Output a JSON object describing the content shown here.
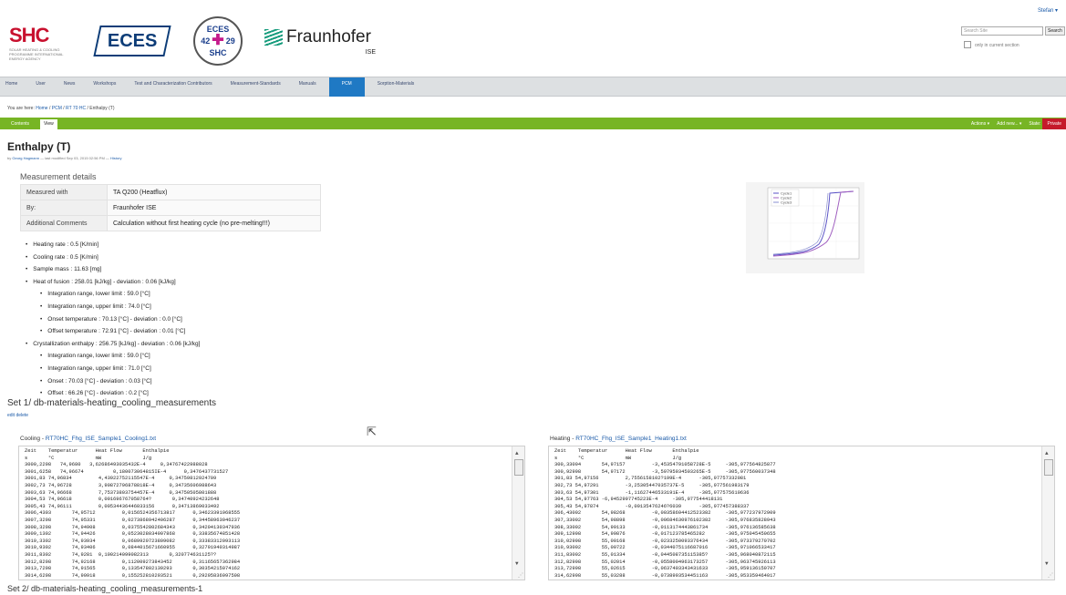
{
  "header": {
    "logos": {
      "shc": {
        "text": "SHC",
        "subtitle": "SOLAR HEATING & COOLING PROGRAMME INTERNATIONAL ENERGY AGENCY"
      },
      "eces": {
        "text": "ECES"
      },
      "eces_annex": {
        "top": "ECES",
        "left": "42",
        "right": "29",
        "bottom": "SHC"
      },
      "fraunhofer": {
        "name": "Fraunhofer",
        "sub": "ISE"
      }
    },
    "user_menu": "Stefan ▾",
    "search": {
      "placeholder": "Search Site",
      "button": "Search",
      "checkbox_label": "only in current section"
    }
  },
  "nav": {
    "items": [
      {
        "label": "Home"
      },
      {
        "label": "User"
      },
      {
        "label": "News"
      },
      {
        "label": "Workshops"
      },
      {
        "label": "Test and Characterization Contributors"
      },
      {
        "label": "Measurement-Standards"
      },
      {
        "label": "Manuals"
      },
      {
        "label": "PCM"
      },
      {
        "label": "Sorption-Materials"
      }
    ],
    "active": "PCM"
  },
  "breadcrumb": {
    "prefix": "You are here:",
    "home": "Home",
    "sep1": "/",
    "pcm": "PCM",
    "sep2": "/",
    "rt70": "RT 70 HC",
    "sep3": "/",
    "current": "Enthalpy (T)"
  },
  "toolbar": {
    "tabs": {
      "contents": "Contents",
      "view": "View"
    },
    "actions": "Actions ▾",
    "add_new": "Add new... ▾",
    "state_label": "State:",
    "state": "Private"
  },
  "page": {
    "title": "Enthalpy (T)",
    "byline_prefix": "by",
    "byline_author": "Georg Hagmann",
    "byline_modified": "— last modified Sep 03, 2015 02:56 PM —",
    "byline_history": "History"
  },
  "details": {
    "heading": "Measurement details",
    "rows": [
      {
        "key": "Measured with",
        "value": "TA Q200 (Heatflux)"
      },
      {
        "key": "By:",
        "value": "Fraunhofer ISE"
      },
      {
        "key": "Additional Comments",
        "value": "Calculation without first heating cycle (no pre-melting!!!)"
      }
    ]
  },
  "plot": {
    "legend": [
      "Cycle1",
      "Cycle2",
      "Cycle3"
    ],
    "colors": {
      "cycle1": "#5a52c6",
      "cycle2": "#a05fc0",
      "cycle3": "#8a8fd0"
    }
  },
  "properties": [
    {
      "level": 1,
      "text": "Heating rate      : 0.5 [K/min]"
    },
    {
      "level": 1,
      "text": "Cooling rate      : 0.5 [K/min]"
    },
    {
      "level": 1,
      "text": "Sample mass      : 11.63 [mg]"
    },
    {
      "level": 1,
      "text": "Heat of fusion      : 258.01 [kJ/kg] - deviation      : 0.06 [kJ/kg]"
    },
    {
      "level": 2,
      "text": "Integration range, lower limit      : 59.0 [°C]"
    },
    {
      "level": 2,
      "text": "Integration range, upper limit      : 74.0 [°C]"
    },
    {
      "level": 2,
      "text": "Onset temperature      : 70.13 [°C] - deviation      : 0.0 [°C]"
    },
    {
      "level": 2,
      "text": "Offset temperature      : 72.91 [°C] - deviation      : 0.01 [°C]"
    },
    {
      "level": 1,
      "text": "Crystallization enthalpy      : 256.75 [kJ/kg] - deviation      : 0.06 [kJ/kg]"
    },
    {
      "level": 2,
      "text": "Integration range, lower limit      : 59.0 [°C]"
    },
    {
      "level": 2,
      "text": "Integration range, upper limit      : 71.0 [°C]"
    },
    {
      "level": 2,
      "text": "Onset      : 70.03 [°C] - deviation      : 0.03 [°C]"
    },
    {
      "level": 2,
      "text": "Offset      : 66.26 [°C] - deviation      : 0.2 [°C]"
    }
  ],
  "set1": {
    "title": "Set 1/ db-materials-heating_cooling_measurements",
    "edit": "edit",
    "delete": "delete"
  },
  "cooling": {
    "prefix": "Cooling -",
    "file": "RT70HC_Fhg_ISE_Sample1_Cooling1.txt",
    "lines": [
      "Zeit    Temperatur      Heat Flow       Enthalpie",
      "s       °C              mW              J/g",
      "3000,2298   74,9680   3,62686493035432E-4     0,34767422988028",
      "3001,6258   74,96674          0,180073064815IE-4      0,3476437731527",
      "3001,83 74,96834         4,43922752115547E-4     0,34759812924709",
      "3002,73 74,96728         3,90872796878818E-4     0,34735606988643",
      "3003,63 74,96668         7,75373803754457E-4     0,34750505801888",
      "3004,53 74,96618         0,001696767058764?       0,34740924232648",
      "3005,43 74,96111         0,00534436446033156      0,34713869033492",
      "3006,4303       74,95712         0,0156524356713817      0,34623391968555",
      "3007,3298       74,95331         0,0273868942406287      0,34458963046237",
      "3008,3298       74,94908         0,0375542802684343      0,34204130347936",
      "3009,1302       74,94426         0,0523028034907868      0,33835674851428",
      "3010,3302       74,93934         0,0689920723809082      0,33383312093113",
      "3010,9302       74,93406         0,0844015671660955      0,32791940314987",
      "3011,8302       74,9281  0,100214099082313       0,320774631125??",
      "3012,8298       74,92168         0,112009273843452       0,31165657362984",
      "3013,7298       74,91565         0,133547802139293       0,30354215074162",
      "3014,6298       74,90918         0,155252810293521       0,29295836997508"
    ]
  },
  "heating": {
    "prefix": "Heating -",
    "file": "RT70HC_Fhg_ISE_Sample1_Heating1.txt",
    "lines": [
      "Zeit    Temperatur      Heat Flow       Enthalpie",
      "s       °C              mW              J/g",
      "300,33004       54,97157         -3,45354791058728E-5     -305,977564825877",
      "300,92998       54,97172         -3,59795934503265E-5     -305,977560037348",
      "301,83 54,97156         2,7556158102?199E-4      -305,97757332081",
      "302,73 54,97291         -3,25305447035737E-5     -305,977561983179",
      "303,63 54,97301         -1,11627446533191E-4     -305,977575610636",
      "304,53 54,97763 -6,9452997745223E-4     -305,977544418131",
      "305,43 54,97874         -0,00135476246?6039      -305,977457388337",
      "306,43002       54,98268         -0,00358694412523382     -305,977237972909",
      "307,33002       54,98898         -0,00684630976102382     -305,976835828943",
      "308,33002       54,99133         -0,0113174443861734      -305,976136585638",
      "309,12998       54,99876         -0,017123785465282       -305,975045450655",
      "310,02998       55,00168         -0,0233250093376434      -305,973379270702",
      "310,93002       55,00722         -0,0344075116687016      -305,971066533417",
      "311,83002       55,01334         -0,044508735115385?      -305,968040872115",
      "312,82998       55,02014         -0,0558004963173257      -305,963745926113",
      "313,72998       55,02615         -0,0637403343431633      -305,959136150707",
      "314,62998       55,03288         -0,0738993534451163      -305,953359464017"
    ]
  },
  "set2": {
    "title": "Set 2/ db-materials-heating_cooling_measurements-1"
  }
}
